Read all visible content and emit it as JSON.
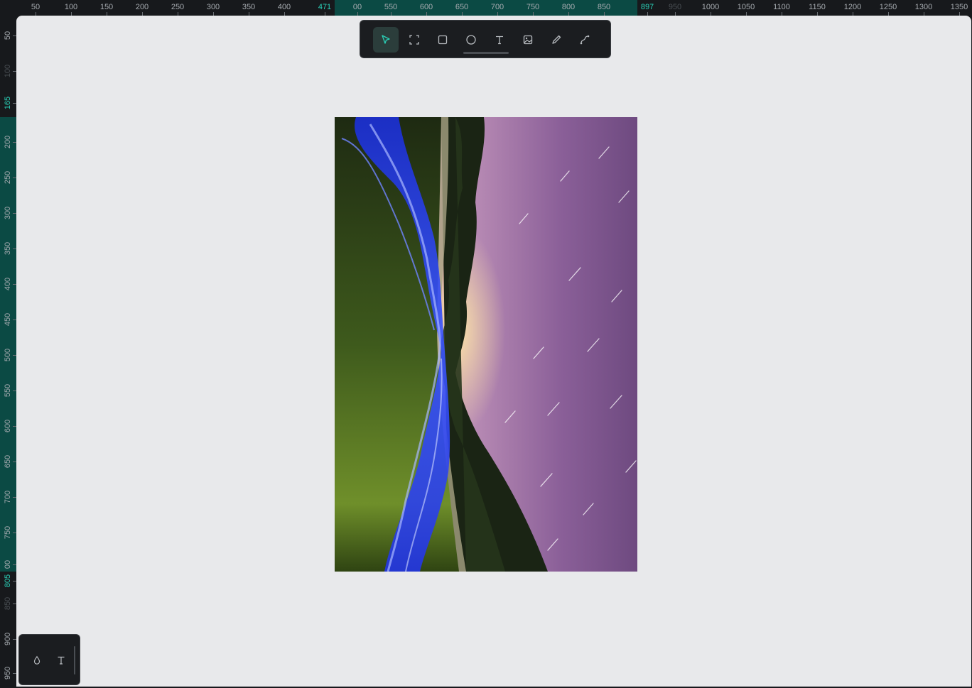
{
  "ruler_top": {
    "ticks": [
      {
        "label": "50",
        "state": "normal"
      },
      {
        "label": "100",
        "state": "normal"
      },
      {
        "label": "150",
        "state": "normal"
      },
      {
        "label": "200",
        "state": "normal"
      },
      {
        "label": "250",
        "state": "normal"
      },
      {
        "label": "300",
        "state": "normal"
      },
      {
        "label": "350",
        "state": "normal"
      },
      {
        "label": "400",
        "state": "normal"
      },
      {
        "label": "471",
        "state": "accent"
      },
      {
        "label": "00",
        "state": "normal"
      },
      {
        "label": "550",
        "state": "normal"
      },
      {
        "label": "600",
        "state": "normal"
      },
      {
        "label": "650",
        "state": "normal"
      },
      {
        "label": "700",
        "state": "normal"
      },
      {
        "label": "750",
        "state": "normal"
      },
      {
        "label": "800",
        "state": "normal"
      },
      {
        "label": "850",
        "state": "normal"
      },
      {
        "label": "897",
        "state": "accent"
      },
      {
        "label": "950",
        "state": "faded"
      },
      {
        "label": "1000",
        "state": "normal"
      },
      {
        "label": "1050",
        "state": "normal"
      },
      {
        "label": "1100",
        "state": "normal"
      },
      {
        "label": "1150",
        "state": "normal"
      },
      {
        "label": "1200",
        "state": "normal"
      },
      {
        "label": "1250",
        "state": "normal"
      },
      {
        "label": "1300",
        "state": "normal"
      },
      {
        "label": "1350",
        "state": "normal"
      }
    ]
  },
  "ruler_left": {
    "ticks": [
      {
        "label": "50",
        "state": "normal"
      },
      {
        "label": "100",
        "state": "faded"
      },
      {
        "label": "165",
        "state": "accent"
      },
      {
        "label": "200",
        "state": "normal"
      },
      {
        "label": "250",
        "state": "normal"
      },
      {
        "label": "300",
        "state": "normal"
      },
      {
        "label": "350",
        "state": "normal"
      },
      {
        "label": "400",
        "state": "normal"
      },
      {
        "label": "450",
        "state": "normal"
      },
      {
        "label": "500",
        "state": "normal"
      },
      {
        "label": "550",
        "state": "normal"
      },
      {
        "label": "600",
        "state": "normal"
      },
      {
        "label": "650",
        "state": "normal"
      },
      {
        "label": "700",
        "state": "normal"
      },
      {
        "label": "750",
        "state": "normal"
      },
      {
        "label": "00",
        "state": "normal"
      },
      {
        "label": "805",
        "state": "accent"
      },
      {
        "label": "850",
        "state": "faded"
      },
      {
        "label": "900",
        "state": "normal"
      },
      {
        "label": "950",
        "state": "normal"
      }
    ]
  },
  "toolbar": {
    "tools": [
      {
        "name": "select",
        "icon": "cursor-icon",
        "active": true
      },
      {
        "name": "frame",
        "icon": "frame-icon",
        "active": false
      },
      {
        "name": "rectangle",
        "icon": "rectangle-icon",
        "active": false
      },
      {
        "name": "ellipse",
        "icon": "ellipse-icon",
        "active": false
      },
      {
        "name": "text",
        "icon": "text-icon",
        "active": false
      },
      {
        "name": "image",
        "icon": "image-icon",
        "active": false
      },
      {
        "name": "pencil",
        "icon": "pencil-icon",
        "active": false
      },
      {
        "name": "path",
        "icon": "path-icon",
        "active": false
      }
    ]
  },
  "panel": {
    "buttons": [
      {
        "name": "fill",
        "icon": "droplet-icon"
      },
      {
        "name": "typography",
        "icon": "text-icon"
      }
    ]
  },
  "colors": {
    "accent": "#2ad1b8",
    "ruler_highlight": "#0b4a44",
    "canvas_bg": "#e8e9eb",
    "chrome_bg": "#17191c"
  }
}
